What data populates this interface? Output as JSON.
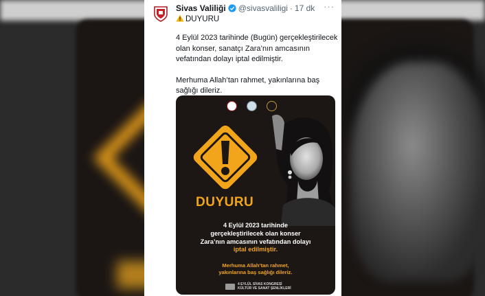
{
  "account": {
    "name": "Sivas Valiliği",
    "handle": "@sivasvaliligi",
    "separator": "·",
    "time": "17 dk",
    "more": "···"
  },
  "tweet": {
    "title": "DUYURU",
    "paragraph1": "4 Eylül 2023 tarihinde (Bugün) gerçekleştirilecek olan konser, sanatçı Zara’nın amcasının vefatından dolayı iptal edilmiştir.",
    "paragraph2": "Merhuma Allah’tan rahmet, yakınlarına baş sağlığı dileriz."
  },
  "poster": {
    "heading": "DUYURU",
    "line1": "4 Eylül 2023 tarihinde",
    "line2": "gerçekleştirilecek olan konser",
    "line3": "Zara’nın amcasının vefatından dolayı",
    "line4": "iptal edilmiştir.",
    "sub1": "Merhuma Allah’tan rahmet,",
    "sub2": "yakınlarına baş sağlığı dileriz.",
    "footer1": "4 EYLÜL SİVAS KONGRESİ",
    "footer2": "KÜLTÜR VE SANAT ŞENLİKLERİ"
  },
  "colors": {
    "accent": "#f2a51a",
    "poster_bg": "#1c1715",
    "verified": "#1d9bf0",
    "text": "#0f1419",
    "muted": "#536471"
  },
  "icons": [
    "avatar-icon",
    "verified-badge-icon",
    "more-icon",
    "warning-icon"
  ]
}
